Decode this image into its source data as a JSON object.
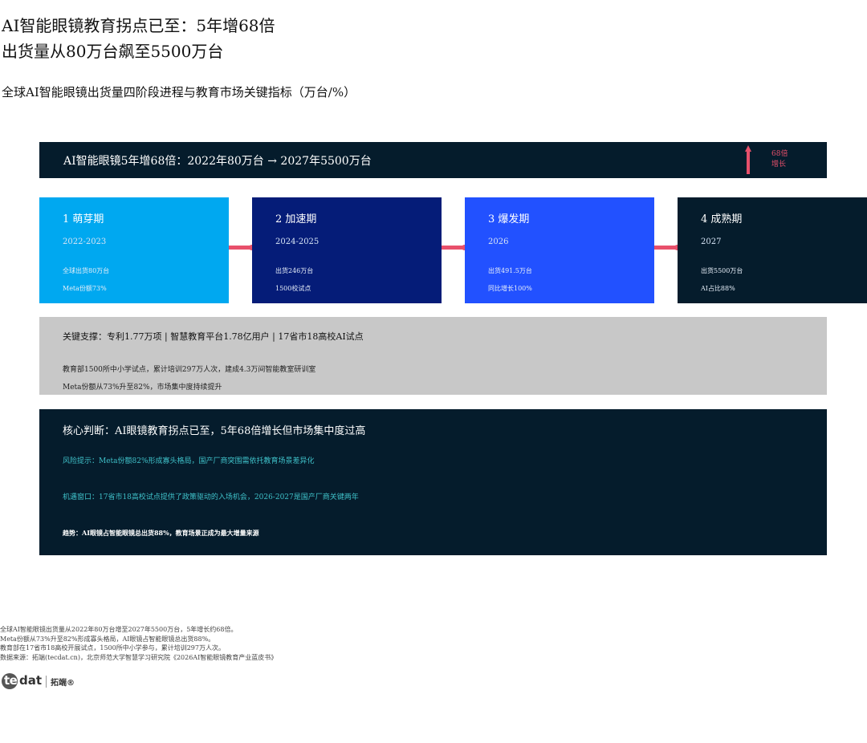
{
  "header": {
    "title_line1": "AI智能眼镜教育拐点已至：5年增68倍",
    "title_line2": "出货量从80万台飙至5500万台",
    "subtitle": "全球AI智能眼镜出货量四阶段进程与教育市场关键指标（万台/%）"
  },
  "banner": {
    "text": "AI智能眼镜5年增68倍：2022年80万台 → 2027年5500万台",
    "growth_line1": "68倍",
    "growth_line2": "增长",
    "accent_color": "#e8506b"
  },
  "stages": [
    {
      "title": "1 萌芽期",
      "years": "2022-2023",
      "line1": "全球出货80万台",
      "line2": "Meta份额73%",
      "color": "#00a8f0"
    },
    {
      "title": "2 加速期",
      "years": "2024-2025",
      "line1": "出货246万台",
      "line2": "1500校试点",
      "color": "#051c78"
    },
    {
      "title": "3 爆发期",
      "years": "2026",
      "line1": "出货491.5万台",
      "line2": "同比增长100%",
      "color": "#2251ff"
    },
    {
      "title": "4 成熟期",
      "years": "2027",
      "line1": "出货5500万台",
      "line2": "AI占比88%",
      "color": "#051c2c"
    }
  ],
  "support": {
    "title": "关键支撑：专利1.77万项 | 智慧教育平台1.78亿用户 | 17省市18高校AI试点",
    "line1": "教育部1500所中小学试点，累计培训297万人次，建成4.3万间智能教室研训室",
    "line2": "Meta份额从73%升至82%，市场集中度持续提升"
  },
  "judgement": {
    "title": "核心判断：AI眼镜教育拐点已至，5年68倍增长但市场集中度过高",
    "risk": "风险提示：Meta份额82%形成寡头格局，国产厂商突围需依托教育场景差异化",
    "opportunity": "机遇窗口：17省市18高校试点提供了政策驱动的入场机会，2026-2027是国产厂商关键两年",
    "trend": "趋势：AI眼镜占智能眼镜总出货88%，教育场景正成为最大增量来源"
  },
  "notes": [
    "全球AI智能眼镜出货量从2022年80万台增至2027年5500万台，5年增长约68倍。",
    "Meta份额从73%升至82%形成寡头格局，AI眼镜占智能眼镜总出货88%。",
    "教育部在17省市18高校开展试点，1500所中小学参与，累计培训297万人次。",
    "数据来源：拓端(tecdat.cn)，北京师范大学智慧学习研究院《2026AI智能眼镜教育产业蓝皮书》"
  ],
  "logo": {
    "tec": "tec",
    "dat": "dat",
    "cn": "拓端®"
  }
}
